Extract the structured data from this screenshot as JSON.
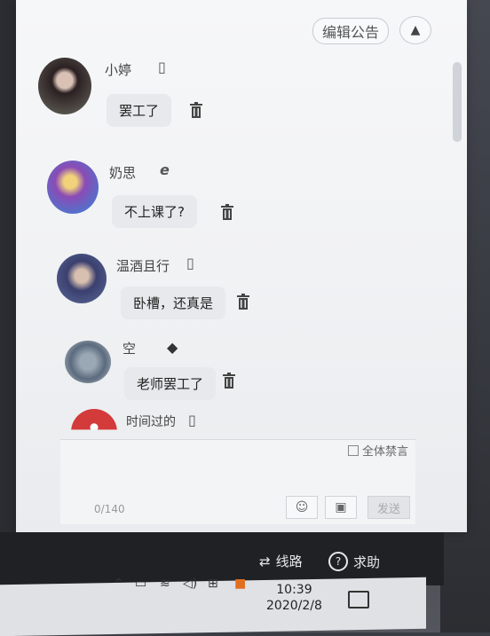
{
  "announcement": {
    "edit_label": "编辑公告"
  },
  "messages": [
    {
      "name": "小婷",
      "device": "mobile-icon",
      "text": "罢工了"
    },
    {
      "name": "奶思",
      "device": "ie-browser-icon",
      "text": "不上课了?"
    },
    {
      "name": "温酒且行",
      "device": "mobile-icon",
      "text": "卧槽，还真是"
    },
    {
      "name": "空",
      "device": "android-icon",
      "text": "老师罢工了"
    },
    {
      "name": "时间过的",
      "device": "mobile-icon",
      "text": ""
    }
  ],
  "input": {
    "mute_all_label": "全体禁言",
    "counter": "0/140",
    "send_label": "发送"
  },
  "footer": {
    "route_label": "线路",
    "help_label": "求助"
  },
  "taskbar": {
    "time": "10:39",
    "date": "2020/2/8"
  },
  "colors": {
    "bubble": "#e8e9ec",
    "window_bg": "#f3f4f6",
    "footer_bg": "#1f2125"
  }
}
